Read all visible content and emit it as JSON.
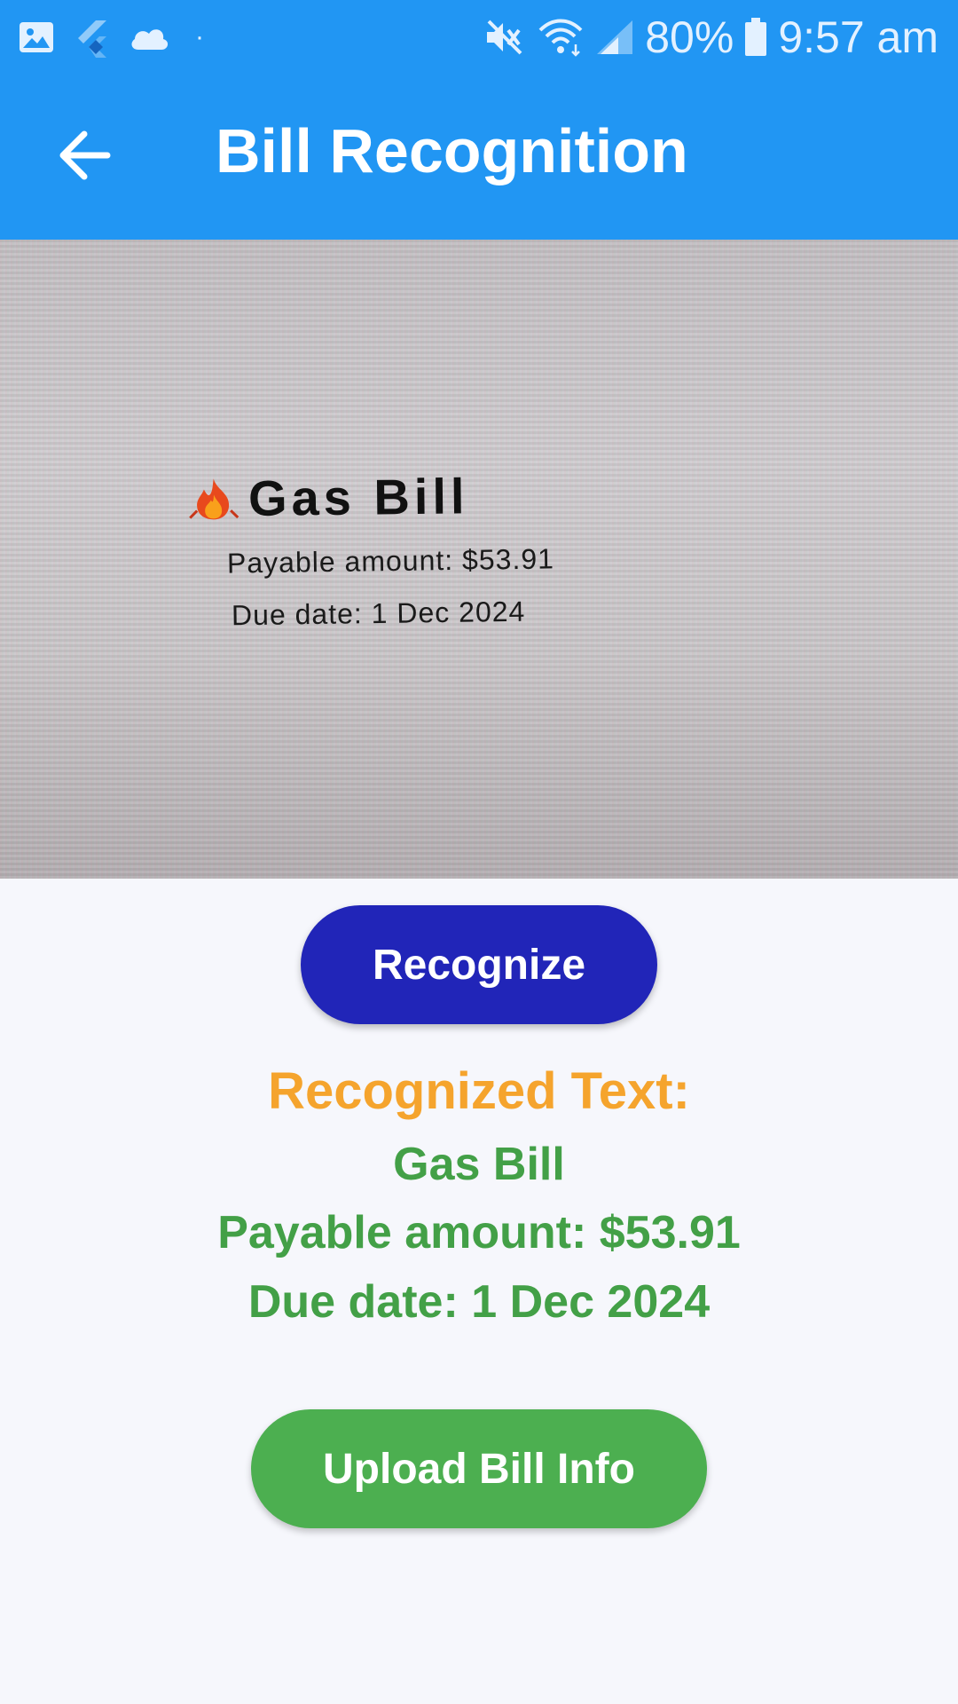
{
  "status_bar": {
    "battery": "80%",
    "time": "9:57 am",
    "dot": "·",
    "icons": [
      "gallery-icon",
      "flutter-icon",
      "cloud-icon",
      "mute-icon",
      "wifi-icon",
      "signal-icon",
      "battery-icon"
    ]
  },
  "app_bar": {
    "title": "Bill Recognition",
    "back_icon": "arrow-left-icon"
  },
  "photo": {
    "title": "Gas Bill",
    "line1": "Payable amount: $53.91",
    "line2": "Due date: 1 Dec 2024",
    "icon": "fire-emoji"
  },
  "actions": {
    "recognize_label": "Recognize",
    "upload_label": "Upload Bill Info"
  },
  "result": {
    "heading": "Recognized Text:",
    "lines": [
      "Gas Bill",
      "Payable amount: $53.91",
      "Due date: 1 Dec 2024"
    ]
  },
  "colors": {
    "app_bar": "#2196f3",
    "recognize_button": "#2125b8",
    "heading": "#f5a42d",
    "result_text": "#43a047",
    "upload_button": "#4caf50",
    "background": "#f6f7fc"
  }
}
